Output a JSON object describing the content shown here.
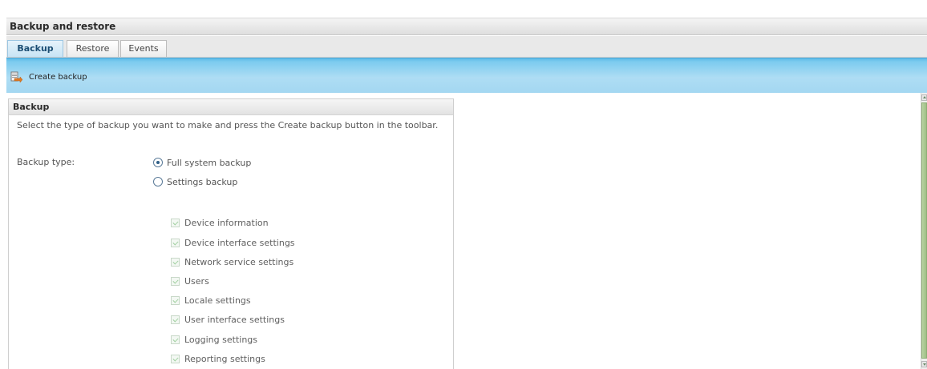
{
  "window": {
    "title": "Backup and restore"
  },
  "tabs": [
    {
      "label": "Backup",
      "active": true
    },
    {
      "label": "Restore",
      "active": false
    },
    {
      "label": "Events",
      "active": false
    }
  ],
  "toolbar": {
    "create_backup_label": "Create backup",
    "create_backup_icon": "backup-arrow-icon"
  },
  "panel": {
    "title": "Backup",
    "description": "Select the type of backup you want to make and press the Create backup button in the toolbar.",
    "backup_type_label": "Backup type:",
    "options": [
      {
        "label": "Full system backup",
        "selected": true
      },
      {
        "label": "Settings backup",
        "selected": false
      }
    ],
    "settings": [
      {
        "label": "Device information",
        "checked": true,
        "enabled": false
      },
      {
        "label": "Device interface settings",
        "checked": true,
        "enabled": false
      },
      {
        "label": "Network service settings",
        "checked": true,
        "enabled": false
      },
      {
        "label": "Users",
        "checked": true,
        "enabled": false
      },
      {
        "label": "Locale settings",
        "checked": true,
        "enabled": false
      },
      {
        "label": "User interface settings",
        "checked": true,
        "enabled": false
      },
      {
        "label": "Logging settings",
        "checked": true,
        "enabled": false
      },
      {
        "label": "Reporting settings",
        "checked": true,
        "enabled": false
      }
    ]
  },
  "colors": {
    "toolbar": "#a3d7f1",
    "active_tab": "#c8e4f5",
    "scroll_thumb": "#9fbf86"
  }
}
